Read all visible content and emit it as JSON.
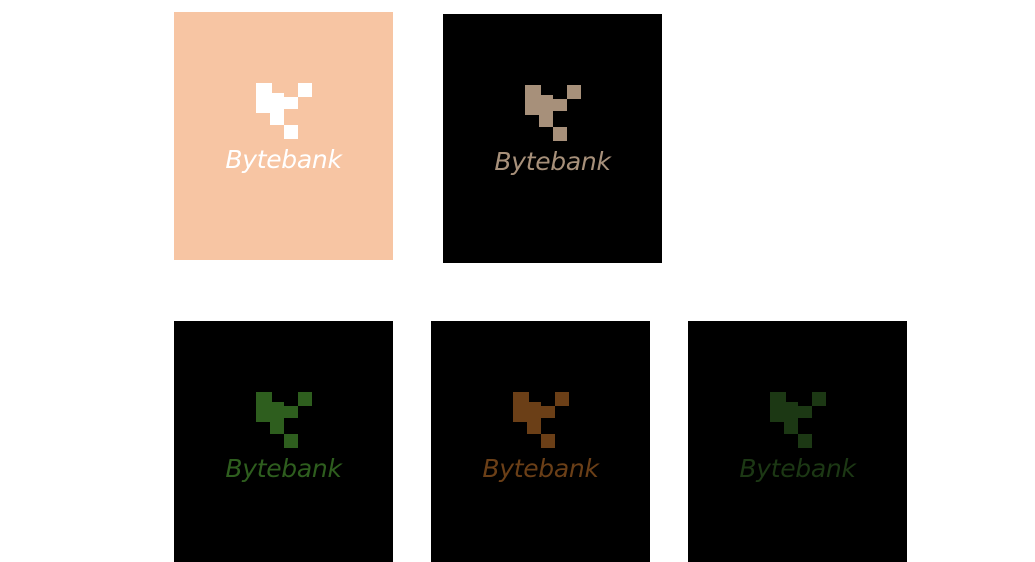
{
  "logos": [
    {
      "text": "Bytebank",
      "background": "#f7c5a3",
      "mark_color": "#ffffff",
      "text_color": "#ffffff"
    },
    {
      "text": "Bytebank",
      "background": "#000000",
      "mark_color": "#a7907a",
      "text_color": "#a7907a"
    },
    {
      "text": "Bytebank",
      "background": "#000000",
      "mark_color": "#2e5e1e",
      "text_color": "#2e5e1e"
    },
    {
      "text": "Bytebank",
      "background": "#000000",
      "mark_color": "#6b3f17",
      "text_color": "#6b3f17"
    },
    {
      "text": "Bytebank",
      "background": "#000000",
      "mark_color": "#1c3814",
      "text_color": "#1c3814"
    }
  ],
  "mark_icon": "bytebank-pixel-logo-icon"
}
